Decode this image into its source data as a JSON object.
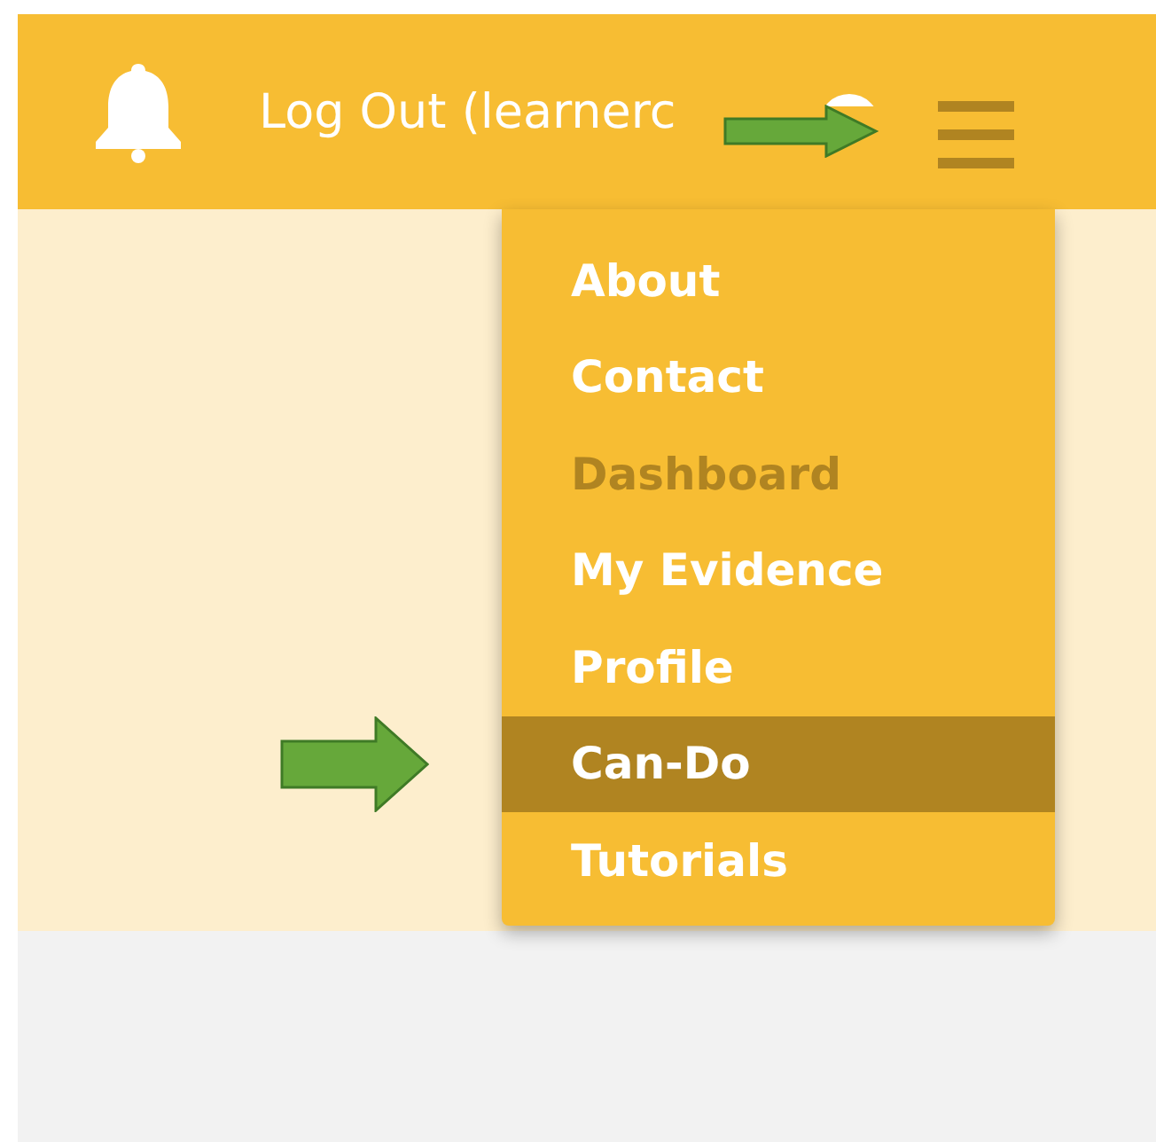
{
  "header": {
    "account_link": "Log Out (learnerc"
  },
  "menu": [
    {
      "label": "About",
      "selected": false,
      "disabled": false
    },
    {
      "label": "Contact",
      "selected": false,
      "disabled": false
    },
    {
      "label": "Dashboard",
      "selected": false,
      "disabled": true
    },
    {
      "label": "My Evidence",
      "selected": false,
      "disabled": false
    },
    {
      "label": "Profile",
      "selected": false,
      "disabled": false
    },
    {
      "label": "Can-Do",
      "selected": true,
      "disabled": false
    },
    {
      "label": "Tutorials",
      "selected": false,
      "disabled": false
    }
  ]
}
